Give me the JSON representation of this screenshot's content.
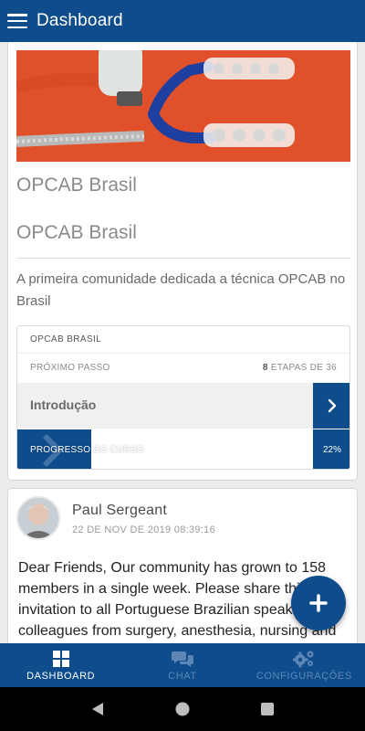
{
  "app_bar": {
    "title": "Dashboard",
    "menu_icon": "hamburger-menu-icon"
  },
  "course_card": {
    "title": "OPCAB Brasil",
    "subtitle": "OPCAB Brasil",
    "description": "A primeira comunidade dedicada a técnica OPCAB no Brasil",
    "box": {
      "header": "OPCAB BRASIL",
      "next_step_label": "PRÓXIMO PASSO",
      "steps_count": "8",
      "steps_text": "ETAPAS DE 36",
      "current_step": "Introdução",
      "progress_label": "PROGRESSO DO CURSO",
      "progress_value": "22%",
      "progress_fraction": 0.22
    }
  },
  "post": {
    "author": "Paul Sergeant",
    "date": "22 DE NOV DE 2019 08:39:16",
    "body": "Dear Friends, Our community has grown to 158 members in a single week. Please share this invitation to all Portuguese Brazilian speaking colleagues from surgery, anesthesia, nursing and perfusion, in-"
  },
  "fab": {
    "icon": "plus-icon"
  },
  "bottom_nav": {
    "items": [
      {
        "label": "DASHBOARD",
        "icon": "dashboard-grid-icon",
        "active": true
      },
      {
        "label": "CHAT",
        "icon": "chat-bubbles-icon",
        "active": false
      },
      {
        "label": "CONFIGURAÇÕES",
        "icon": "gears-icon",
        "active": false
      }
    ]
  },
  "system_nav": {
    "back_icon": "back-triangle-icon",
    "home_icon": "home-circle-icon",
    "recents_icon": "recents-square-icon"
  },
  "colors": {
    "primary": "#0e4c8c",
    "background": "#ececec",
    "inactive_nav": "#5e86b5",
    "hero_background": "#e0502a"
  }
}
